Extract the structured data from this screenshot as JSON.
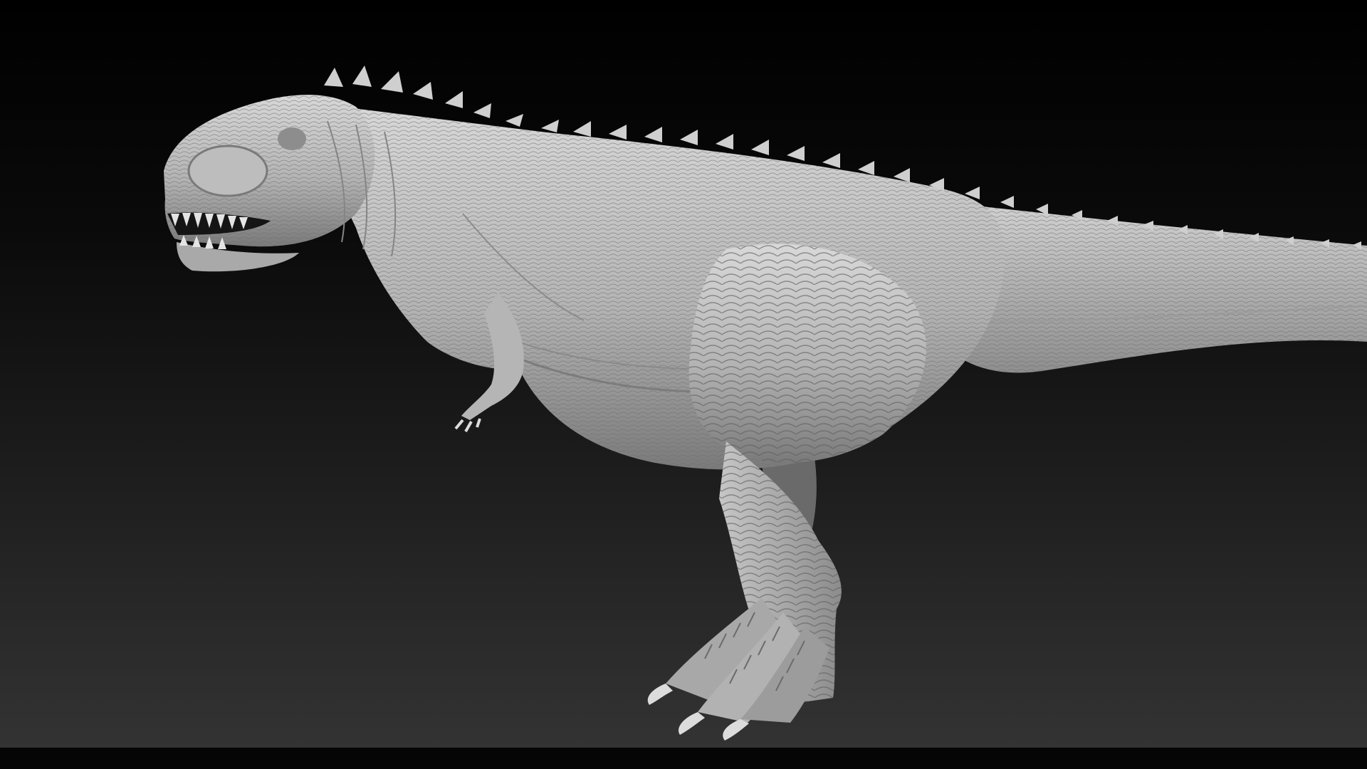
{
  "scene": {
    "subject": "dinosaur-sculpt-render",
    "colors": {
      "background_top": "#000000",
      "background_bottom": "#333333",
      "sculpt_light": "#d4d4d4",
      "sculpt_mid": "#a6a6a6",
      "sculpt_dark": "#5a5a5a",
      "bottom_strip": "#050505"
    }
  }
}
